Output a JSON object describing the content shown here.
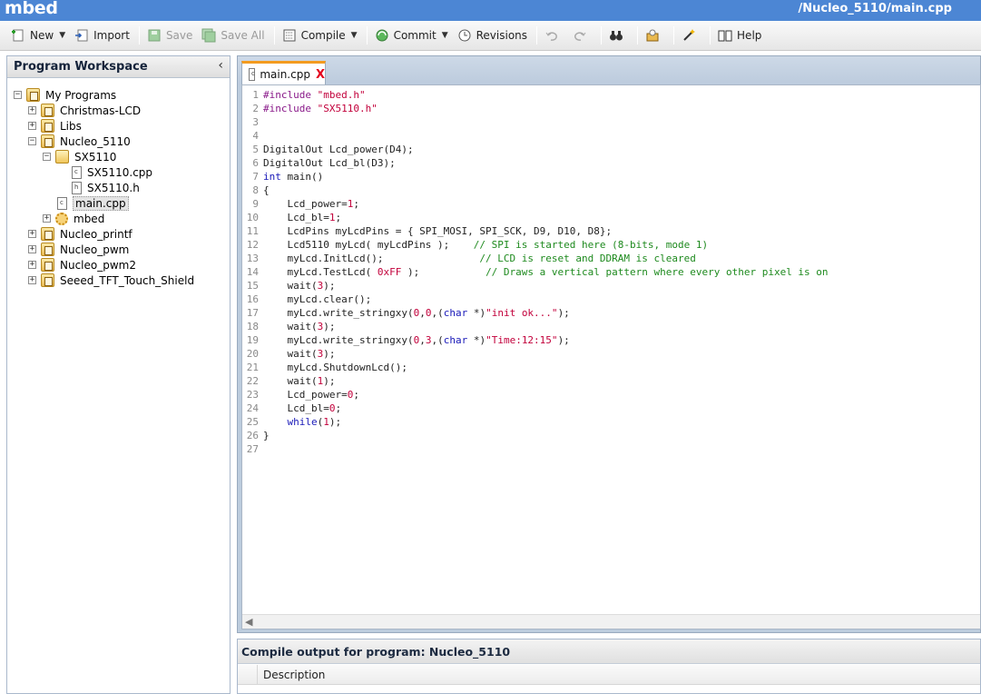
{
  "app": {
    "brand": "mbed",
    "path": "/Nucleo_5110/main.cpp"
  },
  "toolbar": {
    "new": "New",
    "import": "Import",
    "save": "Save",
    "save_all": "Save All",
    "compile": "Compile",
    "commit": "Commit",
    "revisions": "Revisions",
    "help": "Help"
  },
  "workspace": {
    "title": "Program Workspace",
    "collapse_glyph": "‹",
    "root": "My Programs",
    "items": {
      "christmas": "Christmas-LCD",
      "libs": "Libs",
      "nucleo5110": "Nucleo_5110",
      "sx5110": "SX5110",
      "sx5110cpp": "SX5110.cpp",
      "sx5110h": "SX5110.h",
      "maincpp": "main.cpp",
      "mbed": "mbed",
      "printf": "Nucleo_printf",
      "pwm": "Nucleo_pwm",
      "pwm2": "Nucleo_pwm2",
      "seeed": "Seeed_TFT_Touch_Shield"
    }
  },
  "editor": {
    "tab_name": "main.cpp",
    "tab_close": "X",
    "lines": [
      [
        [
          "pp",
          "#include "
        ],
        [
          "st",
          "\"mbed.h\""
        ]
      ],
      [
        [
          "pp",
          "#include "
        ],
        [
          "st",
          "\"SX5110.h\""
        ]
      ],
      [],
      [],
      [
        [
          "",
          "DigitalOut Lcd_power(D4);"
        ]
      ],
      [
        [
          "",
          "DigitalOut Lcd_bl(D3);"
        ]
      ],
      [
        [
          "kw",
          "int"
        ],
        [
          "",
          " main()"
        ]
      ],
      [
        [
          "",
          "{"
        ]
      ],
      [
        [
          "",
          "    Lcd_power="
        ],
        [
          "nu",
          "1"
        ],
        [
          "",
          ";"
        ]
      ],
      [
        [
          "",
          "    Lcd_bl="
        ],
        [
          "nu",
          "1"
        ],
        [
          "",
          ";"
        ]
      ],
      [
        [
          "",
          "    LcdPins myLcdPins = { SPI_MOSI, SPI_SCK, D9, D10, D8};"
        ]
      ],
      [
        [
          "",
          "    Lcd5110 myLcd( myLcdPins );    "
        ],
        [
          "cm",
          "// SPI is started here (8-bits, mode 1)"
        ]
      ],
      [
        [
          "",
          "    myLcd.InitLcd();                "
        ],
        [
          "cm",
          "// LCD is reset and DDRAM is cleared"
        ]
      ],
      [
        [
          "",
          "    myLcd.TestLcd( "
        ],
        [
          "nu",
          "0xFF"
        ],
        [
          "",
          " );           "
        ],
        [
          "cm",
          "// Draws a vertical pattern where every other pixel is on"
        ]
      ],
      [
        [
          "",
          "    wait("
        ],
        [
          "nu",
          "3"
        ],
        [
          "",
          ");"
        ]
      ],
      [
        [
          "",
          "    myLcd.clear();"
        ]
      ],
      [
        [
          "",
          "    myLcd.write_stringxy("
        ],
        [
          "nu",
          "0"
        ],
        [
          "",
          ","
        ],
        [
          "nu",
          "0"
        ],
        [
          "",
          ",("
        ],
        [
          "kw",
          "char"
        ],
        [
          "",
          " *)"
        ],
        [
          "st",
          "\"init ok...\""
        ],
        [
          "",
          ");"
        ]
      ],
      [
        [
          "",
          "    wait("
        ],
        [
          "nu",
          "3"
        ],
        [
          "",
          ");"
        ]
      ],
      [
        [
          "",
          "    myLcd.write_stringxy("
        ],
        [
          "nu",
          "0"
        ],
        [
          "",
          ","
        ],
        [
          "nu",
          "3"
        ],
        [
          "",
          ",("
        ],
        [
          "kw",
          "char"
        ],
        [
          "",
          " *)"
        ],
        [
          "st",
          "\"Time:12:15\""
        ],
        [
          "",
          ");"
        ]
      ],
      [
        [
          "",
          "    wait("
        ],
        [
          "nu",
          "3"
        ],
        [
          "",
          ");"
        ]
      ],
      [
        [
          "",
          "    myLcd.ShutdownLcd();"
        ]
      ],
      [
        [
          "",
          "    wait("
        ],
        [
          "nu",
          "1"
        ],
        [
          "",
          ");"
        ]
      ],
      [
        [
          "",
          "    Lcd_power="
        ],
        [
          "nu",
          "0"
        ],
        [
          "",
          ";"
        ]
      ],
      [
        [
          "",
          "    Lcd_bl="
        ],
        [
          "nu",
          "0"
        ],
        [
          "",
          ";"
        ]
      ],
      [
        [
          "",
          "    "
        ],
        [
          "kw",
          "while"
        ],
        [
          "",
          "("
        ],
        [
          "nu",
          "1"
        ],
        [
          "",
          ");"
        ]
      ],
      [
        [
          "",
          "}"
        ]
      ],
      []
    ]
  },
  "output": {
    "title": "Compile output for program: Nucleo_5110",
    "column": "Description"
  }
}
